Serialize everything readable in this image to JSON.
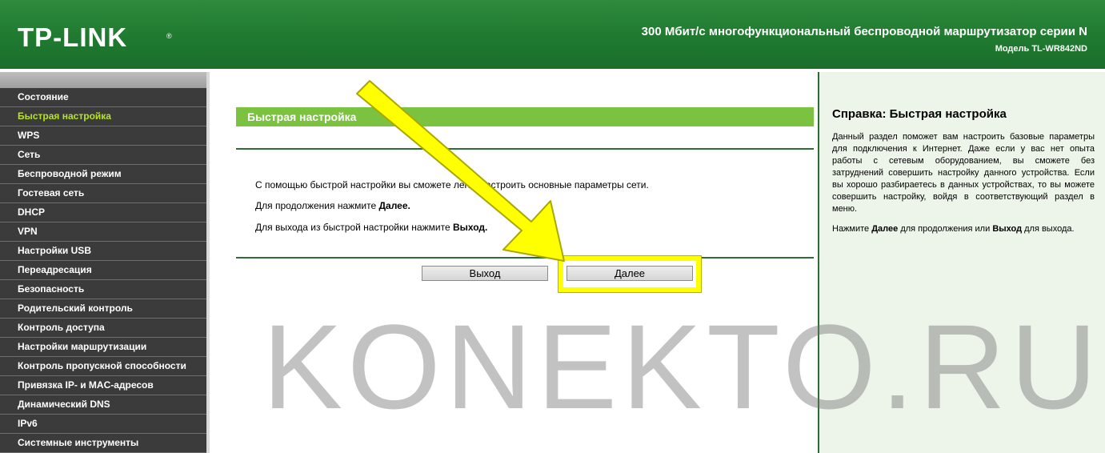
{
  "header": {
    "logo": "TP-LINK",
    "logo_mark": "®",
    "title": "300 Мбит/с многофункциональный беспроводной маршрутизатор серии N",
    "model": "Модель TL-WR842ND"
  },
  "sidebar": {
    "items": [
      {
        "label": "Состояние",
        "active": false
      },
      {
        "label": "Быстрая настройка",
        "active": true
      },
      {
        "label": "WPS",
        "active": false
      },
      {
        "label": "Сеть",
        "active": false
      },
      {
        "label": "Беспроводной режим",
        "active": false
      },
      {
        "label": "Гостевая сеть",
        "active": false
      },
      {
        "label": "DHCP",
        "active": false
      },
      {
        "label": "VPN",
        "active": false
      },
      {
        "label": "Настройки USB",
        "active": false
      },
      {
        "label": "Переадресация",
        "active": false
      },
      {
        "label": "Безопасность",
        "active": false
      },
      {
        "label": "Родительский контроль",
        "active": false
      },
      {
        "label": "Контроль доступа",
        "active": false
      },
      {
        "label": "Настройки маршрутизации",
        "active": false
      },
      {
        "label": "Контроль пропускной способности",
        "active": false
      },
      {
        "label": "Привязка IP- и MAC-адресов",
        "active": false
      },
      {
        "label": "Динамический DNS",
        "active": false
      },
      {
        "label": "IPv6",
        "active": false
      },
      {
        "label": "Системные инструменты",
        "active": false
      }
    ]
  },
  "main": {
    "section_title": "Быстрая настройка",
    "para1": "С помощью быстрой настройки вы сможете легко настроить основные параметры сети.",
    "para2_prefix": "Для продолжения нажмите ",
    "para2_bold": "Далее.",
    "para3_prefix": "Для выхода из быстрой настройки нажмите ",
    "para3_bold": "Выход.",
    "exit_button": "Выход",
    "next_button": "Далее"
  },
  "help": {
    "title": "Справка: Быстрая настройка",
    "text1": "Данный раздел поможет вам настроить базовые параметры для подключения к Интернет. Даже если у вас нет опыта работы с сетевым оборудованием, вы сможете без затруднений совершить настройку данного устройства. Если вы хорошо разбираетесь в данных устройствах, то вы можете совершить настройку, войдя в соответствующий раздел в меню.",
    "text2_a": "Нажмите ",
    "text2_b": "Далее",
    "text2_c": " для продолжения или ",
    "text2_d": "Выход",
    "text2_e": "  для выхода."
  },
  "watermark": "KONEKTO.RU",
  "colors": {
    "header_green": "#1f7a30",
    "section_green": "#7cc241",
    "menu_bg": "#3b3b3b",
    "menu_active": "#b5e61d",
    "highlight_yellow": "#ffff00",
    "help_bg": "#edf5ea"
  }
}
